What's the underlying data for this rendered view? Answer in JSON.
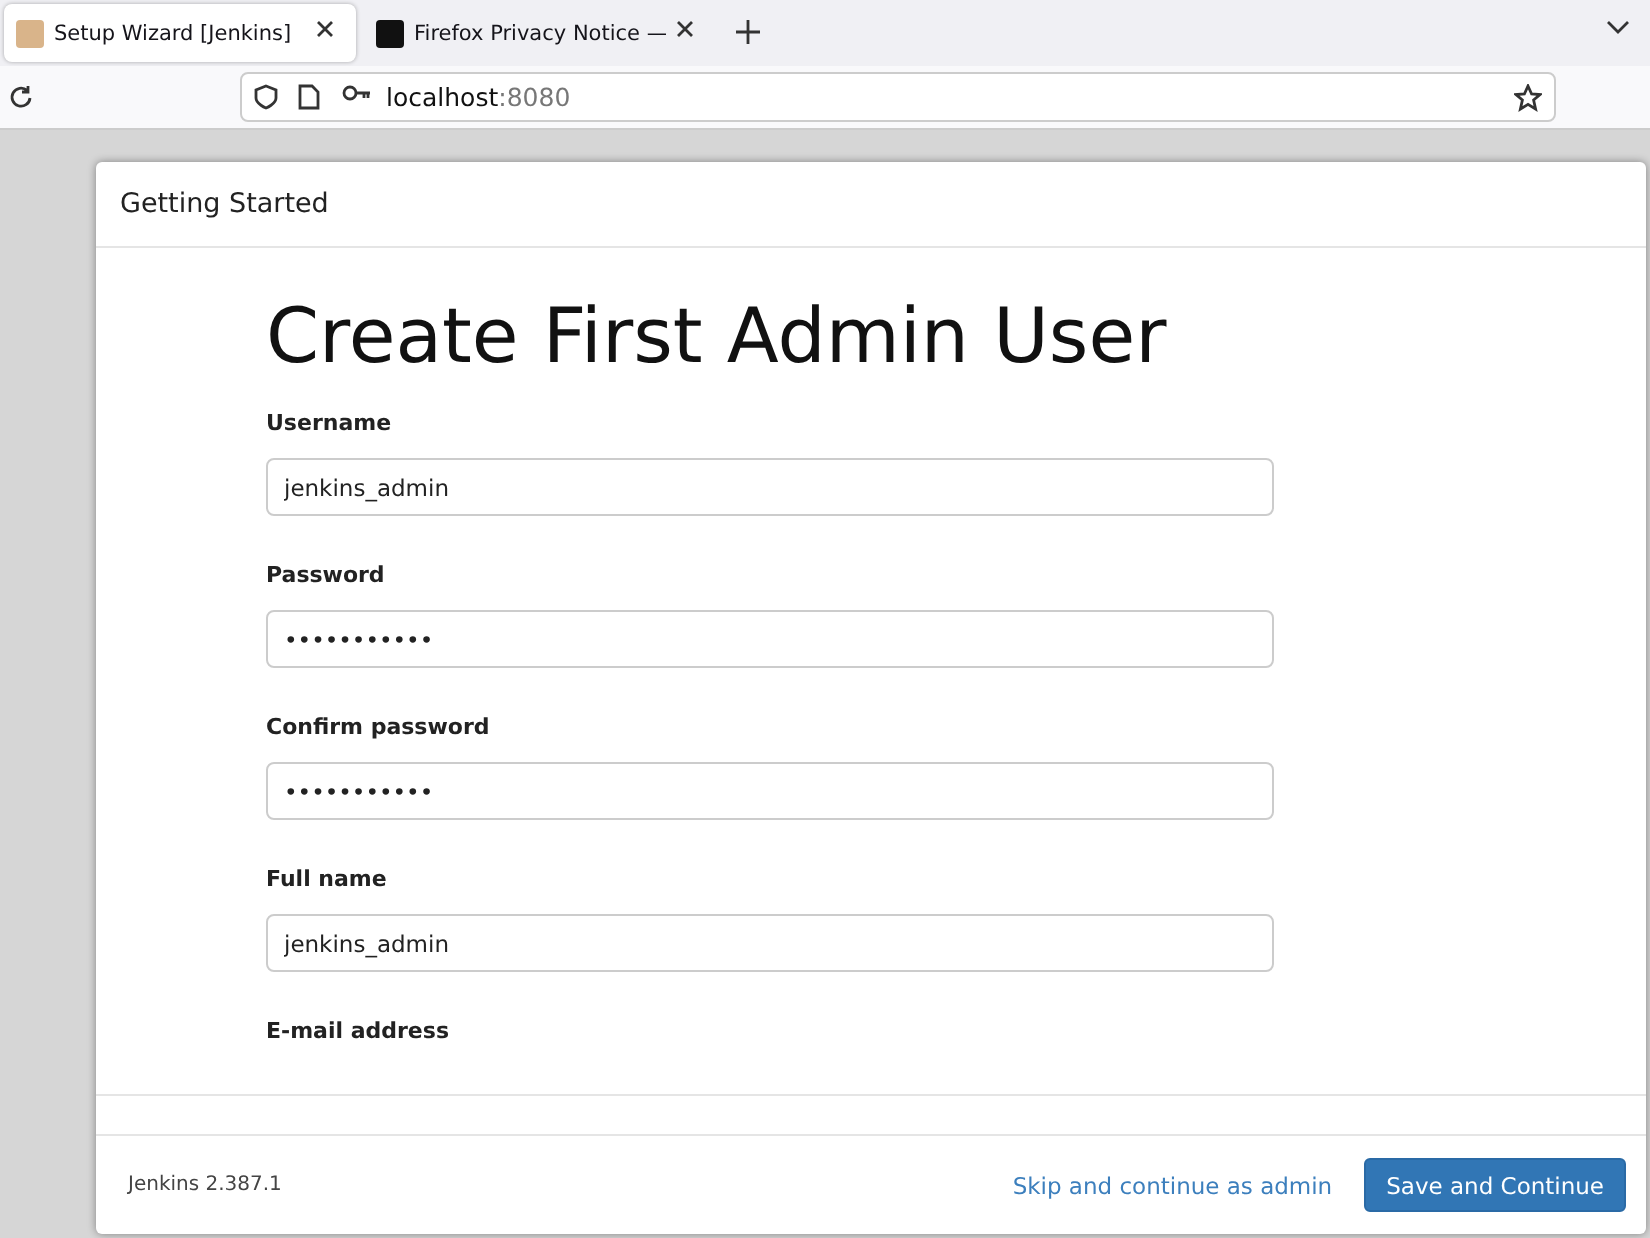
{
  "browser": {
    "tabs": [
      {
        "title": "Setup Wizard [Jenkins]",
        "selected": true
      },
      {
        "title": "Firefox Privacy Notice —",
        "selected": false
      }
    ],
    "address": {
      "host": "localhost",
      "port": ":8080"
    }
  },
  "dialog": {
    "header": "Getting Started",
    "title": "Create First Admin User",
    "fields": [
      {
        "label": "Username",
        "value": "jenkins_admin"
      },
      {
        "label": "Password",
        "value": "•••••••••••"
      },
      {
        "label": "Confirm password",
        "value": "•••••••••••"
      },
      {
        "label": "Full name",
        "value": "jenkins_admin"
      },
      {
        "label": "E-mail address"
      }
    ],
    "version": "Jenkins 2.387.1",
    "skip_link": "Skip and continue as admin",
    "save_button": "Save and Continue"
  }
}
